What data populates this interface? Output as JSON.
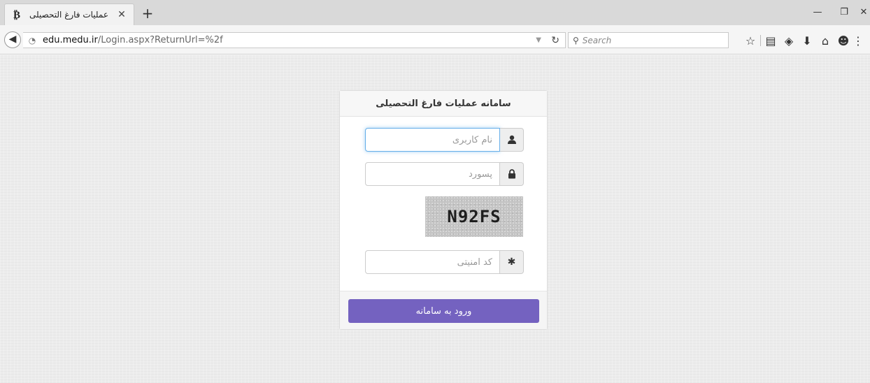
{
  "browser": {
    "tab_title": "عملیات فارغ التحصیلی",
    "tab_favicon": "favicon-icon",
    "new_tab_label": "+",
    "url_domain": "edu.medu.ir",
    "url_path": "/Login.aspx?ReturnUrl=%2f",
    "search_placeholder": "Search",
    "toolbar_icons": [
      "star-icon",
      "library-icon",
      "pocket-icon",
      "download-icon",
      "home-icon",
      "emoji-icon",
      "menu-icon"
    ]
  },
  "login": {
    "header_title": "سامانه عملیات فارغ التحصیلی",
    "username_placeholder": "نام کاربری",
    "password_placeholder": "پسورد",
    "captcha_text": "N92FS",
    "captcha_placeholder": "کد امنیتی",
    "submit_label": "ورود به سامانه"
  },
  "colors": {
    "accent": "#7462c0",
    "focus_border": "#66afe9",
    "page_background": "#ececec"
  }
}
